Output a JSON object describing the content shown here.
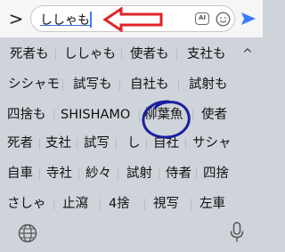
{
  "input": {
    "value": "ししゃも",
    "back_label": ">"
  },
  "candidates": [
    [
      "死者も",
      "ししゃも",
      "使者も",
      "支社も"
    ],
    [
      "シシャモ",
      "試写も",
      "自社も",
      "試射も"
    ],
    [
      "四捨も",
      "SHISHAMO",
      "柳葉魚",
      "使者"
    ],
    [
      "死者",
      "支社",
      "試写",
      "し",
      "自社",
      "サシャ"
    ],
    [
      "自車",
      "寺社",
      "紗々",
      "試射",
      "侍者",
      "四捨"
    ],
    [
      "さしゃ",
      "止瀉",
      "4捨",
      "視写",
      "左車"
    ]
  ],
  "collapse_label": "^",
  "icons": {
    "back": "chevron-right-icon",
    "ai": "ai-icon",
    "emoji": "emoji-icon",
    "send": "send-icon",
    "globe": "globe-icon",
    "mic": "microphone-icon"
  },
  "ai_label": "AI",
  "colors": {
    "send": "#3b7bff",
    "arrow": "#e0242a",
    "circle": "#1a1fa0"
  }
}
